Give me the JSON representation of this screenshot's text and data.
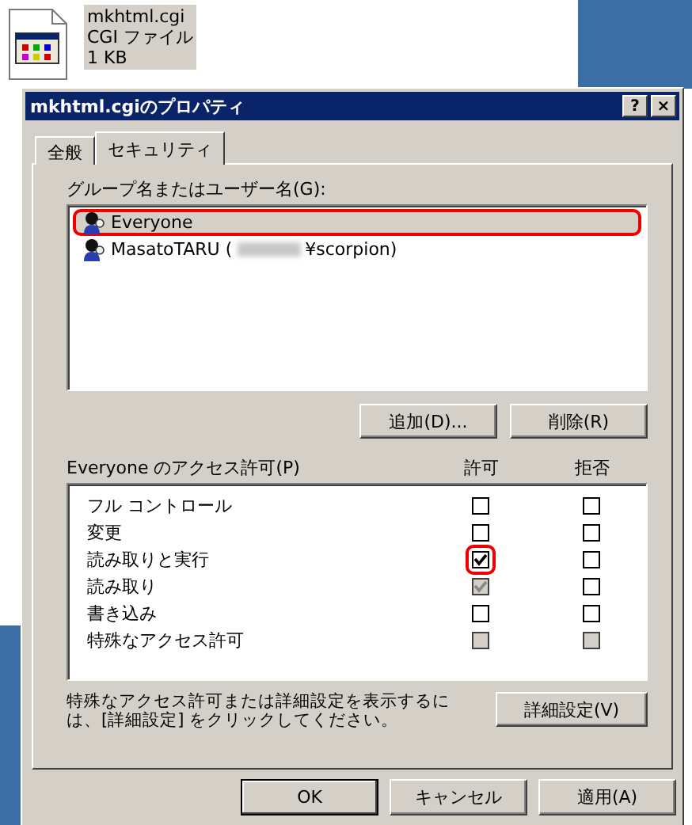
{
  "file": {
    "name": "mkhtml.cgi",
    "type": "CGI ファイル",
    "size": "1 KB",
    "selected": true
  },
  "window": {
    "title": "mkhtml.cgiのプロパティ",
    "help_button": "?",
    "close_button": "×"
  },
  "tabs": [
    {
      "label": "全般",
      "selected": false
    },
    {
      "label": "セキュリティ",
      "selected": true
    }
  ],
  "users_label": "グループ名またはユーザー名(G):",
  "users": [
    {
      "name": "Everyone",
      "selected": true,
      "highlighted": true
    },
    {
      "name": "MasatoTARU (",
      "redacted": true,
      "name_suffix": "¥scorpion)",
      "selected": false,
      "highlighted": false
    }
  ],
  "user_buttons": [
    "追加(D)...",
    "削除(R)"
  ],
  "permissions_label": "Everyone のアクセス許可(P)",
  "columns": [
    "許可",
    "拒否"
  ],
  "permissions": [
    {
      "label": "フル コントロール",
      "allow": {
        "checked": false,
        "disabled": false,
        "highlighted": false
      },
      "deny": {
        "checked": false,
        "disabled": false
      }
    },
    {
      "label": "変更",
      "allow": {
        "checked": false,
        "disabled": false,
        "highlighted": false
      },
      "deny": {
        "checked": false,
        "disabled": false
      }
    },
    {
      "label": "読み取りと実行",
      "allow": {
        "checked": true,
        "disabled": false,
        "highlighted": true
      },
      "deny": {
        "checked": false,
        "disabled": false
      }
    },
    {
      "label": "読み取り",
      "allow": {
        "checked": true,
        "disabled": true,
        "highlighted": false
      },
      "deny": {
        "checked": false,
        "disabled": false
      }
    },
    {
      "label": "書き込み",
      "allow": {
        "checked": false,
        "disabled": false,
        "highlighted": false
      },
      "deny": {
        "checked": false,
        "disabled": false
      }
    },
    {
      "label": "特殊なアクセス許可",
      "allow": {
        "checked": false,
        "disabled": true,
        "highlighted": false
      },
      "deny": {
        "checked": false,
        "disabled": true
      }
    }
  ],
  "advanced_note": "特殊なアクセス許可または詳細設定を表示するには、[詳細設定] をクリックしてください。",
  "advanced_button": "詳細設定(V)",
  "buttons": [
    "OK",
    "キャンセル",
    "適用(A)"
  ]
}
